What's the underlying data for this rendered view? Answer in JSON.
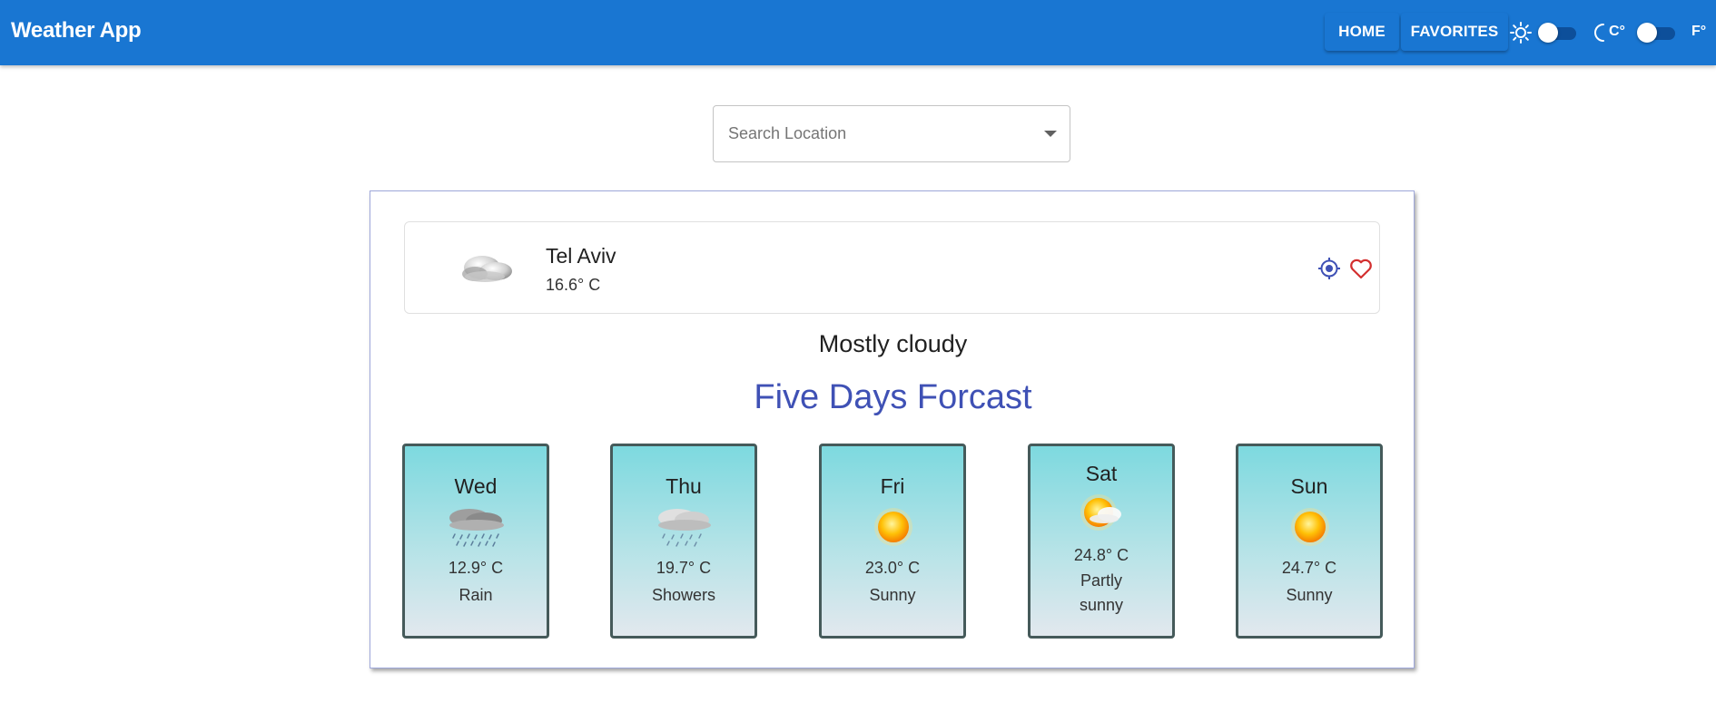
{
  "appbar": {
    "title": "Weather App",
    "nav": {
      "home": "HOME",
      "favorites": "FAVORITES"
    },
    "theme_toggle": {
      "light_icon": "sun-icon",
      "dark_icon": "moon-icon",
      "checked": false
    },
    "unit_toggle": {
      "celsius_label": "C°",
      "fahrenheit_label": "F°",
      "checked": false
    },
    "color": "#1976d2"
  },
  "search": {
    "placeholder": "Search Location",
    "value": ""
  },
  "current": {
    "city": "Tel Aviv",
    "temperature": "16.6° C",
    "icon": "mostly-cloudy-icon",
    "condition": "Mostly cloudy",
    "location_icon": "my-location-icon",
    "favorite_icon": "heart-outline-icon"
  },
  "forecast": {
    "title": "Five Days Forcast",
    "days": [
      {
        "day": "Wed",
        "temp": "12.9° C",
        "desc": "Rain",
        "icon": "rain-icon"
      },
      {
        "day": "Thu",
        "temp": "19.7° C",
        "desc": "Showers",
        "icon": "showers-icon"
      },
      {
        "day": "Fri",
        "temp": "23.0° C",
        "desc": "Sunny",
        "icon": "sun-icon"
      },
      {
        "day": "Sat",
        "temp": "24.8° C",
        "desc": "Partly sunny",
        "icon": "partly-sunny-icon"
      },
      {
        "day": "Sun",
        "temp": "24.7° C",
        "desc": "Sunny",
        "icon": "sun-icon"
      }
    ]
  },
  "colors": {
    "accent": "#3f51b5",
    "favorite": "#d32f2f"
  }
}
